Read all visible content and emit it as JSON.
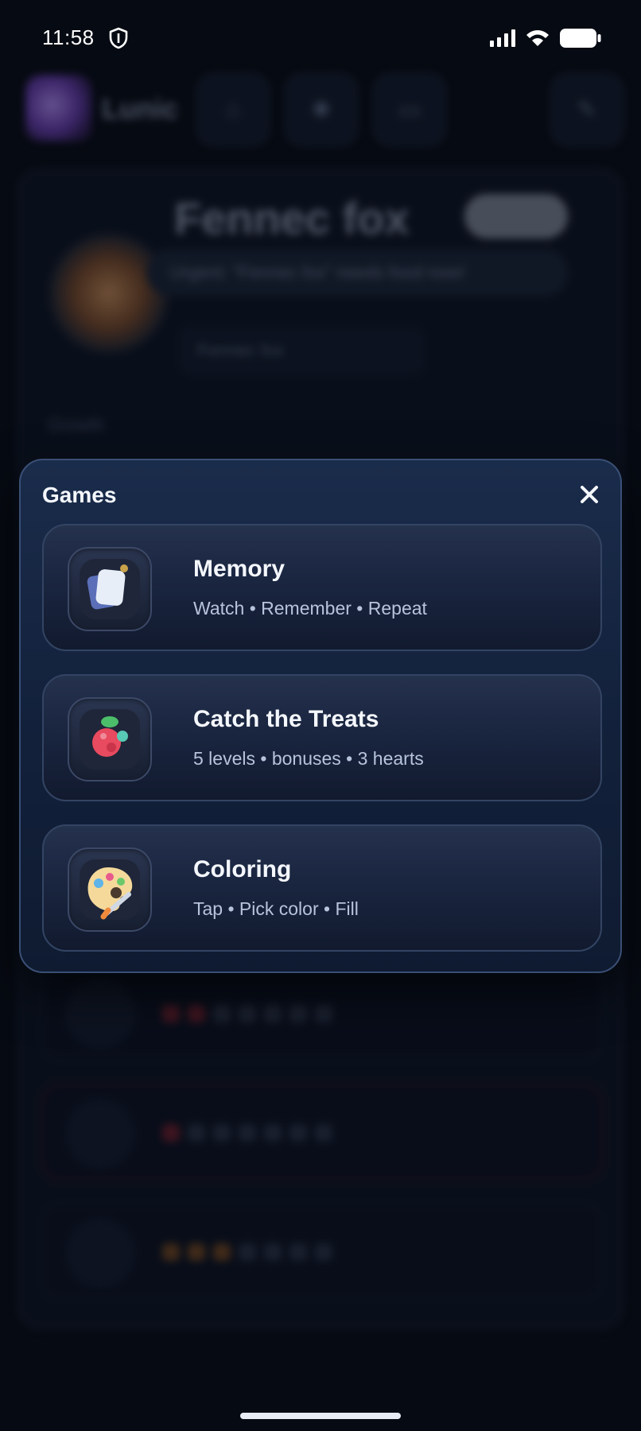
{
  "status_bar": {
    "time": "11:58",
    "icons": [
      "shield-icon",
      "signal-icon",
      "wifi-icon",
      "battery-icon"
    ]
  },
  "background": {
    "app_name": "Lunic",
    "nav_icons": [
      "home-icon",
      "color-wheel-icon",
      "cards-icon",
      "edit-icon"
    ],
    "pet_title": "Fennec fox",
    "alert_text": "Urgent: \"Fennec fox\" needs food now!",
    "pet_select": "Fennec fox",
    "section_label": "Growth"
  },
  "modal": {
    "title": "Games",
    "close_icon": "close-icon",
    "games": [
      {
        "name": "Memory",
        "description": "Watch • Remember • Repeat",
        "icon": "memory-cards-icon"
      },
      {
        "name": "Catch the Treats",
        "description": "5 levels • bonuses • 3 hearts",
        "icon": "treat-icon"
      },
      {
        "name": "Coloring",
        "description": "Tap • Pick color • Fill",
        "icon": "palette-icon"
      }
    ]
  },
  "colors": {
    "modal_bg": "#14233f",
    "modal_border": "#3a4f75",
    "card_bg": "#1c2742",
    "text_primary": "#f4f7fc",
    "text_secondary": "#b7c4dc"
  }
}
